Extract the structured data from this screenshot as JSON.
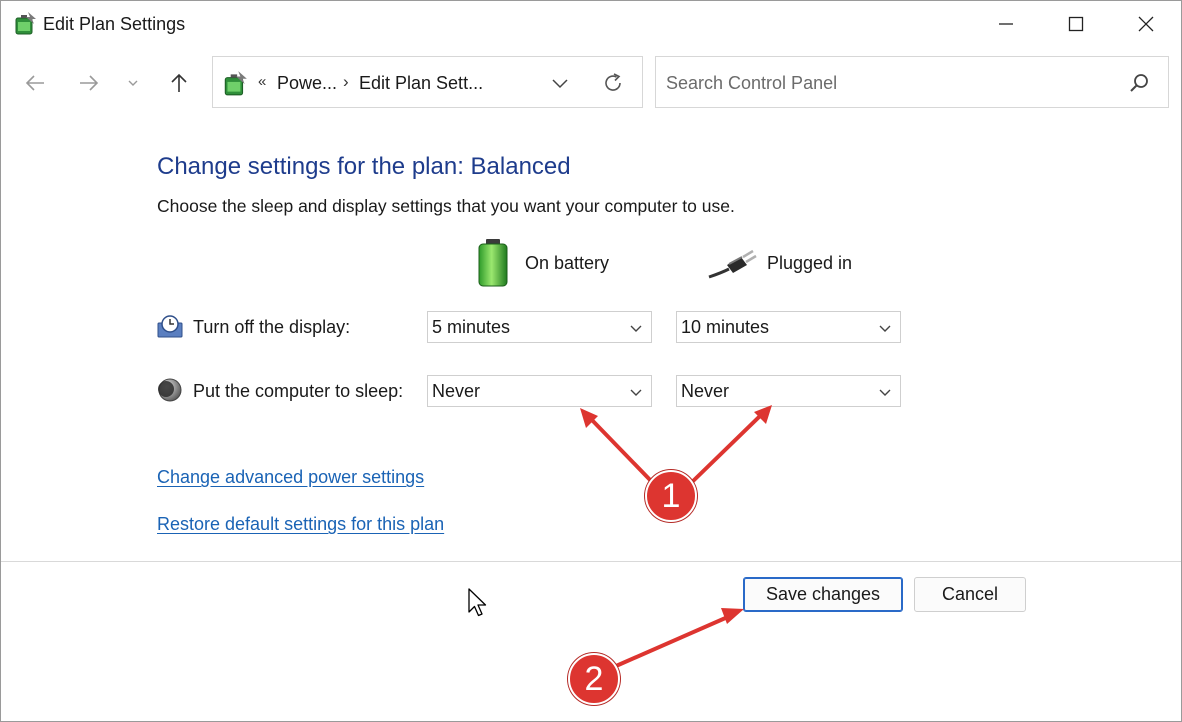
{
  "window": {
    "title": "Edit Plan Settings",
    "minimize_glyph": "—",
    "maximize_glyph": "☐",
    "close_glyph": "✕"
  },
  "nav": {
    "back_icon": "arrow-left-icon",
    "forward_icon": "arrow-right-icon",
    "recent_icon": "chevron-down-icon",
    "up_icon": "arrow-up-icon"
  },
  "address": {
    "overflow": "«",
    "crumbs": [
      "Powe...",
      "Edit Plan Sett..."
    ],
    "separator": "›"
  },
  "search": {
    "placeholder": "Search Control Panel"
  },
  "content": {
    "heading": "Change settings for the plan: Balanced",
    "subtitle": "Choose the sleep and display settings that you want your computer to use.",
    "columns": {
      "on_battery": "On battery",
      "plugged_in": "Plugged in"
    },
    "rows": [
      {
        "label": "Turn off the display:",
        "battery": "5 minutes",
        "plugged": "10 minutes"
      },
      {
        "label": "Put the computer to sleep:",
        "battery": "Never",
        "plugged": "Never"
      }
    ],
    "links": {
      "advanced": "Change advanced power settings",
      "restore": "Restore default settings for this plan"
    }
  },
  "buttons": {
    "save": "Save changes",
    "cancel": "Cancel"
  },
  "annotations": {
    "badge_1": "1",
    "badge_2": "2",
    "color": "#dd3530"
  },
  "colors": {
    "heading": "#1e3c8c",
    "link": "#1a63b5",
    "save_border": "#2a6ac8"
  }
}
